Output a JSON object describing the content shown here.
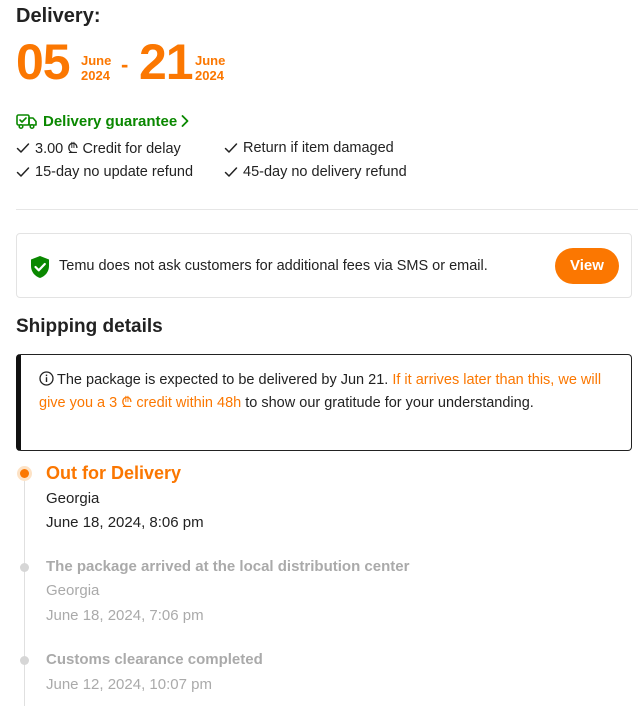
{
  "delivery": {
    "label": "Delivery:",
    "start_day": "05",
    "start_month": "June",
    "start_year": "2024",
    "separator": "-",
    "end_day": "21",
    "end_month": "June",
    "end_year": "2024"
  },
  "guarantee": {
    "title": "Delivery guarantee",
    "perks": [
      "3.00 ₾ Credit for delay",
      "Return if item damaged",
      "15-day no update refund",
      "45-day no delivery refund"
    ]
  },
  "notice": {
    "text": "Temu does not ask customers for additional fees via SMS or email.",
    "button": "View"
  },
  "shipping": {
    "title": "Shipping details",
    "info_part1": "The package is expected to be delivered by Jun 21.",
    "info_highlight": "If it arrives later than this, we will give you a 3 ₾ credit within 48h",
    "info_part2": "to show our gratitude for your understanding.",
    "events": [
      {
        "title": "Out for Delivery",
        "location": "Georgia",
        "time": "June 18, 2024, 8:06 pm"
      },
      {
        "title": "The package arrived at the local distribution center",
        "location": "Georgia",
        "time": "June 18, 2024, 7:06 pm"
      },
      {
        "title": "Customs clearance completed",
        "time": "June 12, 2024, 10:07 pm"
      }
    ]
  },
  "colors": {
    "accent": "#fb7701",
    "guarantee_green": "#0a8800",
    "muted": "#aaaaaa"
  },
  "icons": {
    "truck": "truck-check-icon",
    "chevron": "chevron-right-icon",
    "check": "check-icon",
    "shield": "shield-check-icon",
    "info": "info-circle-icon"
  }
}
